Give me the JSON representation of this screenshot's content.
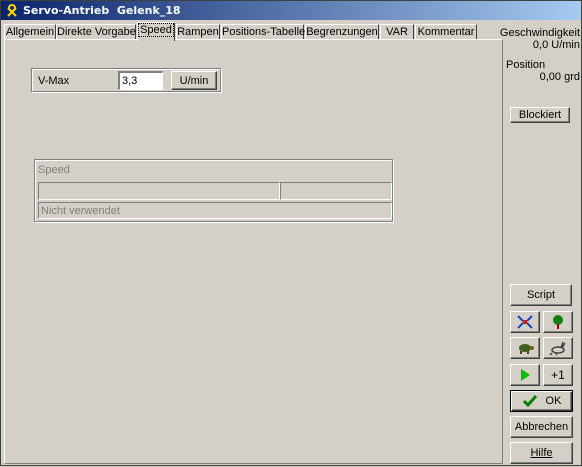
{
  "window": {
    "title": "Servo-Antrieb  Gelenk_18"
  },
  "tabs": [
    {
      "label": "Allgemein"
    },
    {
      "label": "Direkte Vorgabe"
    },
    {
      "label": "Speed",
      "active": true
    },
    {
      "label": "Rampen"
    },
    {
      "label": "Positions-Tabelle"
    },
    {
      "label": "Begrenzungen"
    },
    {
      "label": "VAR"
    },
    {
      "label": "Kommentar"
    }
  ],
  "vmax": {
    "label": "V-Max",
    "value": "3,3",
    "unit_button": "U/min"
  },
  "speed_group": {
    "title": "Speed",
    "status": "Nicht verwendet"
  },
  "side": {
    "velocity_label": "Geschwindigkeit",
    "velocity_value": "0,0 U/min",
    "position_label": "Position",
    "position_value": "0,00 grd",
    "blocked_button": "Blockiert",
    "script_button": "Script",
    "plus_one_button": "+1",
    "ok_button": "OK",
    "cancel_button": "Abbrechen",
    "help_button": "Hilfe"
  },
  "colors": {
    "face": "#d4d0c8",
    "title_start": "#0a246a",
    "title_end": "#a6caf0",
    "ok_check": "#008000",
    "play_arrow": "#00c000"
  }
}
